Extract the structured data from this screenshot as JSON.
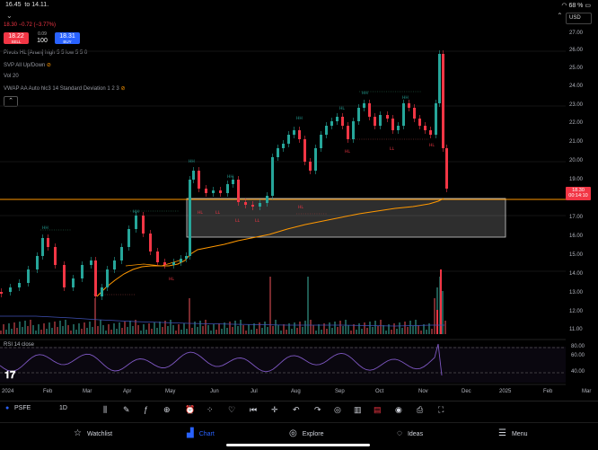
{
  "status_bar": {
    "time": "16.45",
    "date": "to 14.11.",
    "battery": "68 %"
  },
  "currency": "USD",
  "legend": {
    "price_change": "18.30 −0.72 (−3.77%)",
    "sell": {
      "price": "18.22",
      "label": "SELL"
    },
    "buy": {
      "price": "18.31",
      "label": "BUY"
    },
    "spread": "0.09",
    "quantity": "100",
    "indicators": [
      "Pivots HL [Anan]  high 5 5 low 5 5 0",
      "SVP All Up/Down",
      "Vol 20",
      "VWAP AA Auto hlc3 14 Standard Deviation 1 2 3"
    ]
  },
  "price_axis": [
    "27.00",
    "26.00",
    "25.00",
    "24.00",
    "23.00",
    "22.00",
    "21.00",
    "20.00",
    "19.00",
    "17.00",
    "16.00",
    "15.00",
    "14.00",
    "13.00",
    "12.00",
    "11.00"
  ],
  "last_price": {
    "price": "18.30",
    "countdown": "00:14:10"
  },
  "rsi": {
    "label": "RSI 14 close",
    "ticks": [
      "80.00",
      "60.00",
      "40.00"
    ]
  },
  "time_axis": [
    "2024",
    "Feb",
    "Mar",
    "Apr",
    "May",
    "Jun",
    "Jul",
    "Aug",
    "Sep",
    "Oct",
    "Nov",
    "Dec",
    "2025",
    "Feb",
    "Mar"
  ],
  "toolbar": {
    "symbol": "PSFE",
    "interval": "1D"
  },
  "nav": {
    "watchlist": "Watchlist",
    "chart": "Chart",
    "explore": "Explore",
    "ideas": "Ideas",
    "menu": "Menu"
  },
  "colors": {
    "up": "#26a69a",
    "down": "#f23645",
    "vwap": "#ff9800",
    "rsi": "#7e57c2",
    "accent": "#2962ff"
  }
}
